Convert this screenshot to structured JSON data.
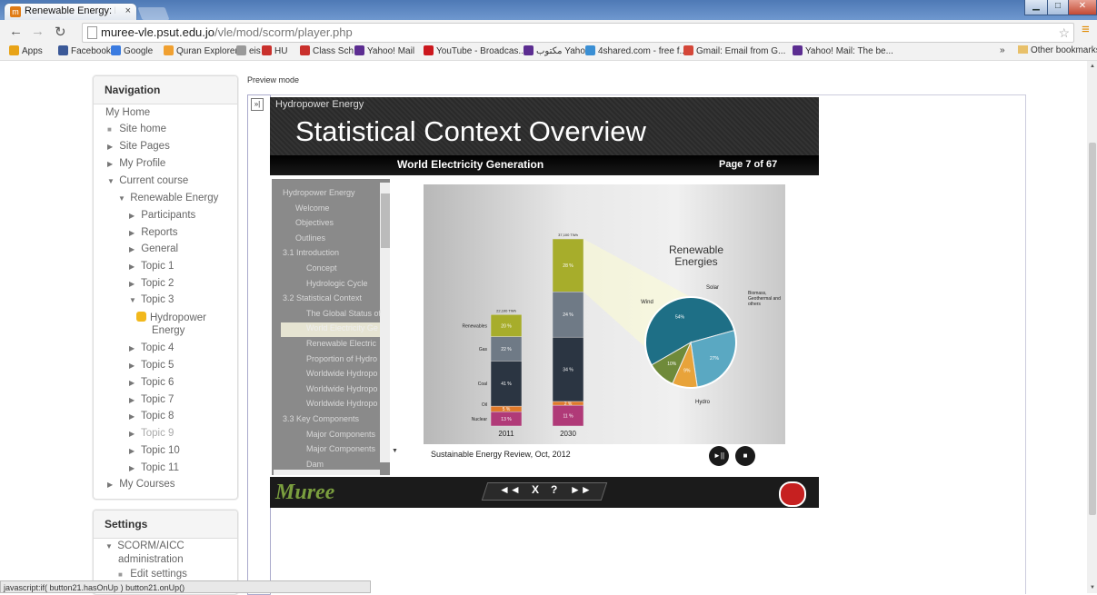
{
  "browser": {
    "tab_title": "Renewable Energy: Hydro",
    "tab_close": "×",
    "url_host": "muree-vle.psut.edu.jo",
    "url_path": "/vle/mod/scorm/player.php",
    "bookmarks": [
      "Apps",
      "Facebook",
      "Google",
      "Quran Explorer",
      "eis",
      "HU",
      "Class Sch",
      "Yahoo! Mail",
      "YouTube - Broadcas...",
      "مكتوب Yahoo!",
      "4shared.com - free f...",
      "Gmail: Email from G...",
      "Yahoo! Mail: The be..."
    ],
    "bookmark_colors": [
      "#e8a317",
      "#3b5998",
      "#3a7be0",
      "#f0a030",
      "#999999",
      "#c9302c",
      "#c9302c",
      "#5c2d91",
      "#cc181e",
      "#5c2d91",
      "#3a8fd4",
      "#d44638",
      "#5c2d91"
    ],
    "bookmarks_more": "»",
    "other_bookmarks": "Other bookmarks",
    "status_text": "javascript:if( button21.hasOnUp ) button21.onUp()"
  },
  "navigation": {
    "heading": "Navigation",
    "my_home": "My Home",
    "site_home": "Site home",
    "site_pages": "Site Pages",
    "my_profile": "My Profile",
    "current_course": "Current course",
    "course": "Renewable Energy",
    "participants": "Participants",
    "reports": "Reports",
    "general": "General",
    "topics": [
      "Topic 1",
      "Topic 2",
      "Topic 3"
    ],
    "activity_line1": "Hydropower",
    "activity_line2": "Energy",
    "topics_after": [
      "Topic 4",
      "Topic 5",
      "Topic 6",
      "Topic 7",
      "Topic 8",
      "Topic 9",
      "Topic 10",
      "Topic 11"
    ],
    "my_courses": "My Courses"
  },
  "settings": {
    "heading": "Settings",
    "scorm_admin_line1": "SCORM/AICC",
    "scorm_admin_line2": "administration",
    "edit_settings": "Edit settings"
  },
  "preview_mode": "Preview mode",
  "frame_toggle": "»|",
  "player": {
    "supertitle": "Hydropower Energy",
    "title": "Statistical Context Overview",
    "subtitle": "World Electricity Generation",
    "page": "Page 7 of 67",
    "toc": [
      "Hydropower Energy",
      "Welcome",
      "Objectives",
      "Outlines",
      "3.1 Introduction",
      "Concept",
      "Hydrologic Cycle",
      "3.2 Statistical Context",
      "The Global Status of",
      "World Electricity Ge",
      "Renewable Electric",
      "Proportion of Hydro",
      "Worldwide Hydropo",
      "Worldwide Hydropo",
      "Worldwide Hydropo",
      "3.3 Key Components",
      "Major Components",
      "Major Components",
      "Dam"
    ],
    "source": "Sustainable Energy Review, Oct, 2012",
    "logo": "Muree",
    "nav_buttons": [
      "◄◄",
      "X",
      "?",
      "►►"
    ],
    "media_buttons": [
      "►||",
      "■"
    ]
  },
  "chart_data": {
    "type": "bar",
    "categories": [
      "2011",
      "2030"
    ],
    "totals": [
      "22,100 TWh",
      "37,100 TWh"
    ],
    "series": [
      {
        "name": "Nuclear",
        "values": [
          13,
          11
        ],
        "labels": [
          "13 %",
          "11 %"
        ],
        "color": "#b03a78"
      },
      {
        "name": "Oil",
        "values": [
          5,
          2
        ],
        "labels": [
          "5 %",
          "2 %"
        ],
        "color": "#e07a2a"
      },
      {
        "name": "Coal",
        "values": [
          41,
          34
        ],
        "labels": [
          "41 %",
          "34 %"
        ],
        "color": "#2b3542"
      },
      {
        "name": "Gas",
        "values": [
          22,
          24
        ],
        "labels": [
          "22 %",
          "24 %"
        ],
        "color": "#6f7a86"
      },
      {
        "name": "Renewables",
        "values": [
          20,
          28
        ],
        "labels": [
          "20 %",
          "28 %"
        ],
        "color": "#a7ad2b"
      }
    ],
    "pie": {
      "title_line1": "Renewable",
      "title_line2": "Energies",
      "slices": [
        {
          "name": "Hydro",
          "value": 54,
          "label": "54%",
          "color": "#1e6f86"
        },
        {
          "name": "Wind",
          "value": 27,
          "label": "27%",
          "color": "#5aa8c2"
        },
        {
          "name": "Solar",
          "value": 9,
          "label": "9%",
          "color": "#e8a33a"
        },
        {
          "name": "Biomass, Geothermal and others",
          "value": 10,
          "label": "10%",
          "color": "#6f8a3a"
        }
      ],
      "callouts": [
        "Solar",
        "Biomass,",
        "Geothermal and",
        "others",
        "Wind",
        "Hydro"
      ]
    }
  }
}
